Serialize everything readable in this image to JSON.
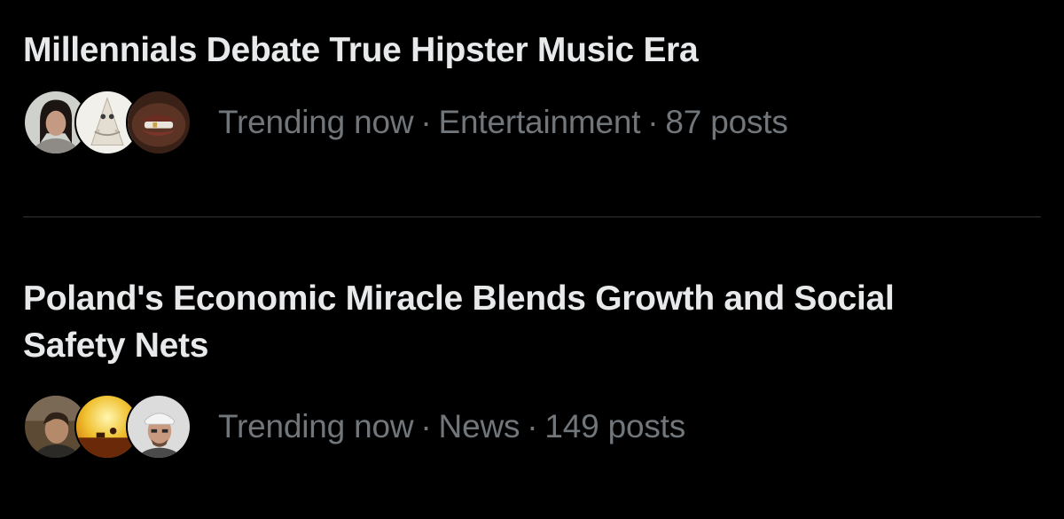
{
  "trends": [
    {
      "title": "Millennials Debate True Hipster Music Era",
      "status": "Trending now",
      "separator": "·",
      "category": "Entertainment",
      "posts": "87 posts"
    },
    {
      "title": "Poland's Economic Miracle Blends Growth and Social Safety Nets",
      "status": "Trending now",
      "separator": "·",
      "category": "News",
      "posts": "149 posts"
    }
  ],
  "colors": {
    "background": "#000000",
    "title_text": "#e7e9ea",
    "meta_text": "#71767b",
    "divider": "#2f3336"
  }
}
